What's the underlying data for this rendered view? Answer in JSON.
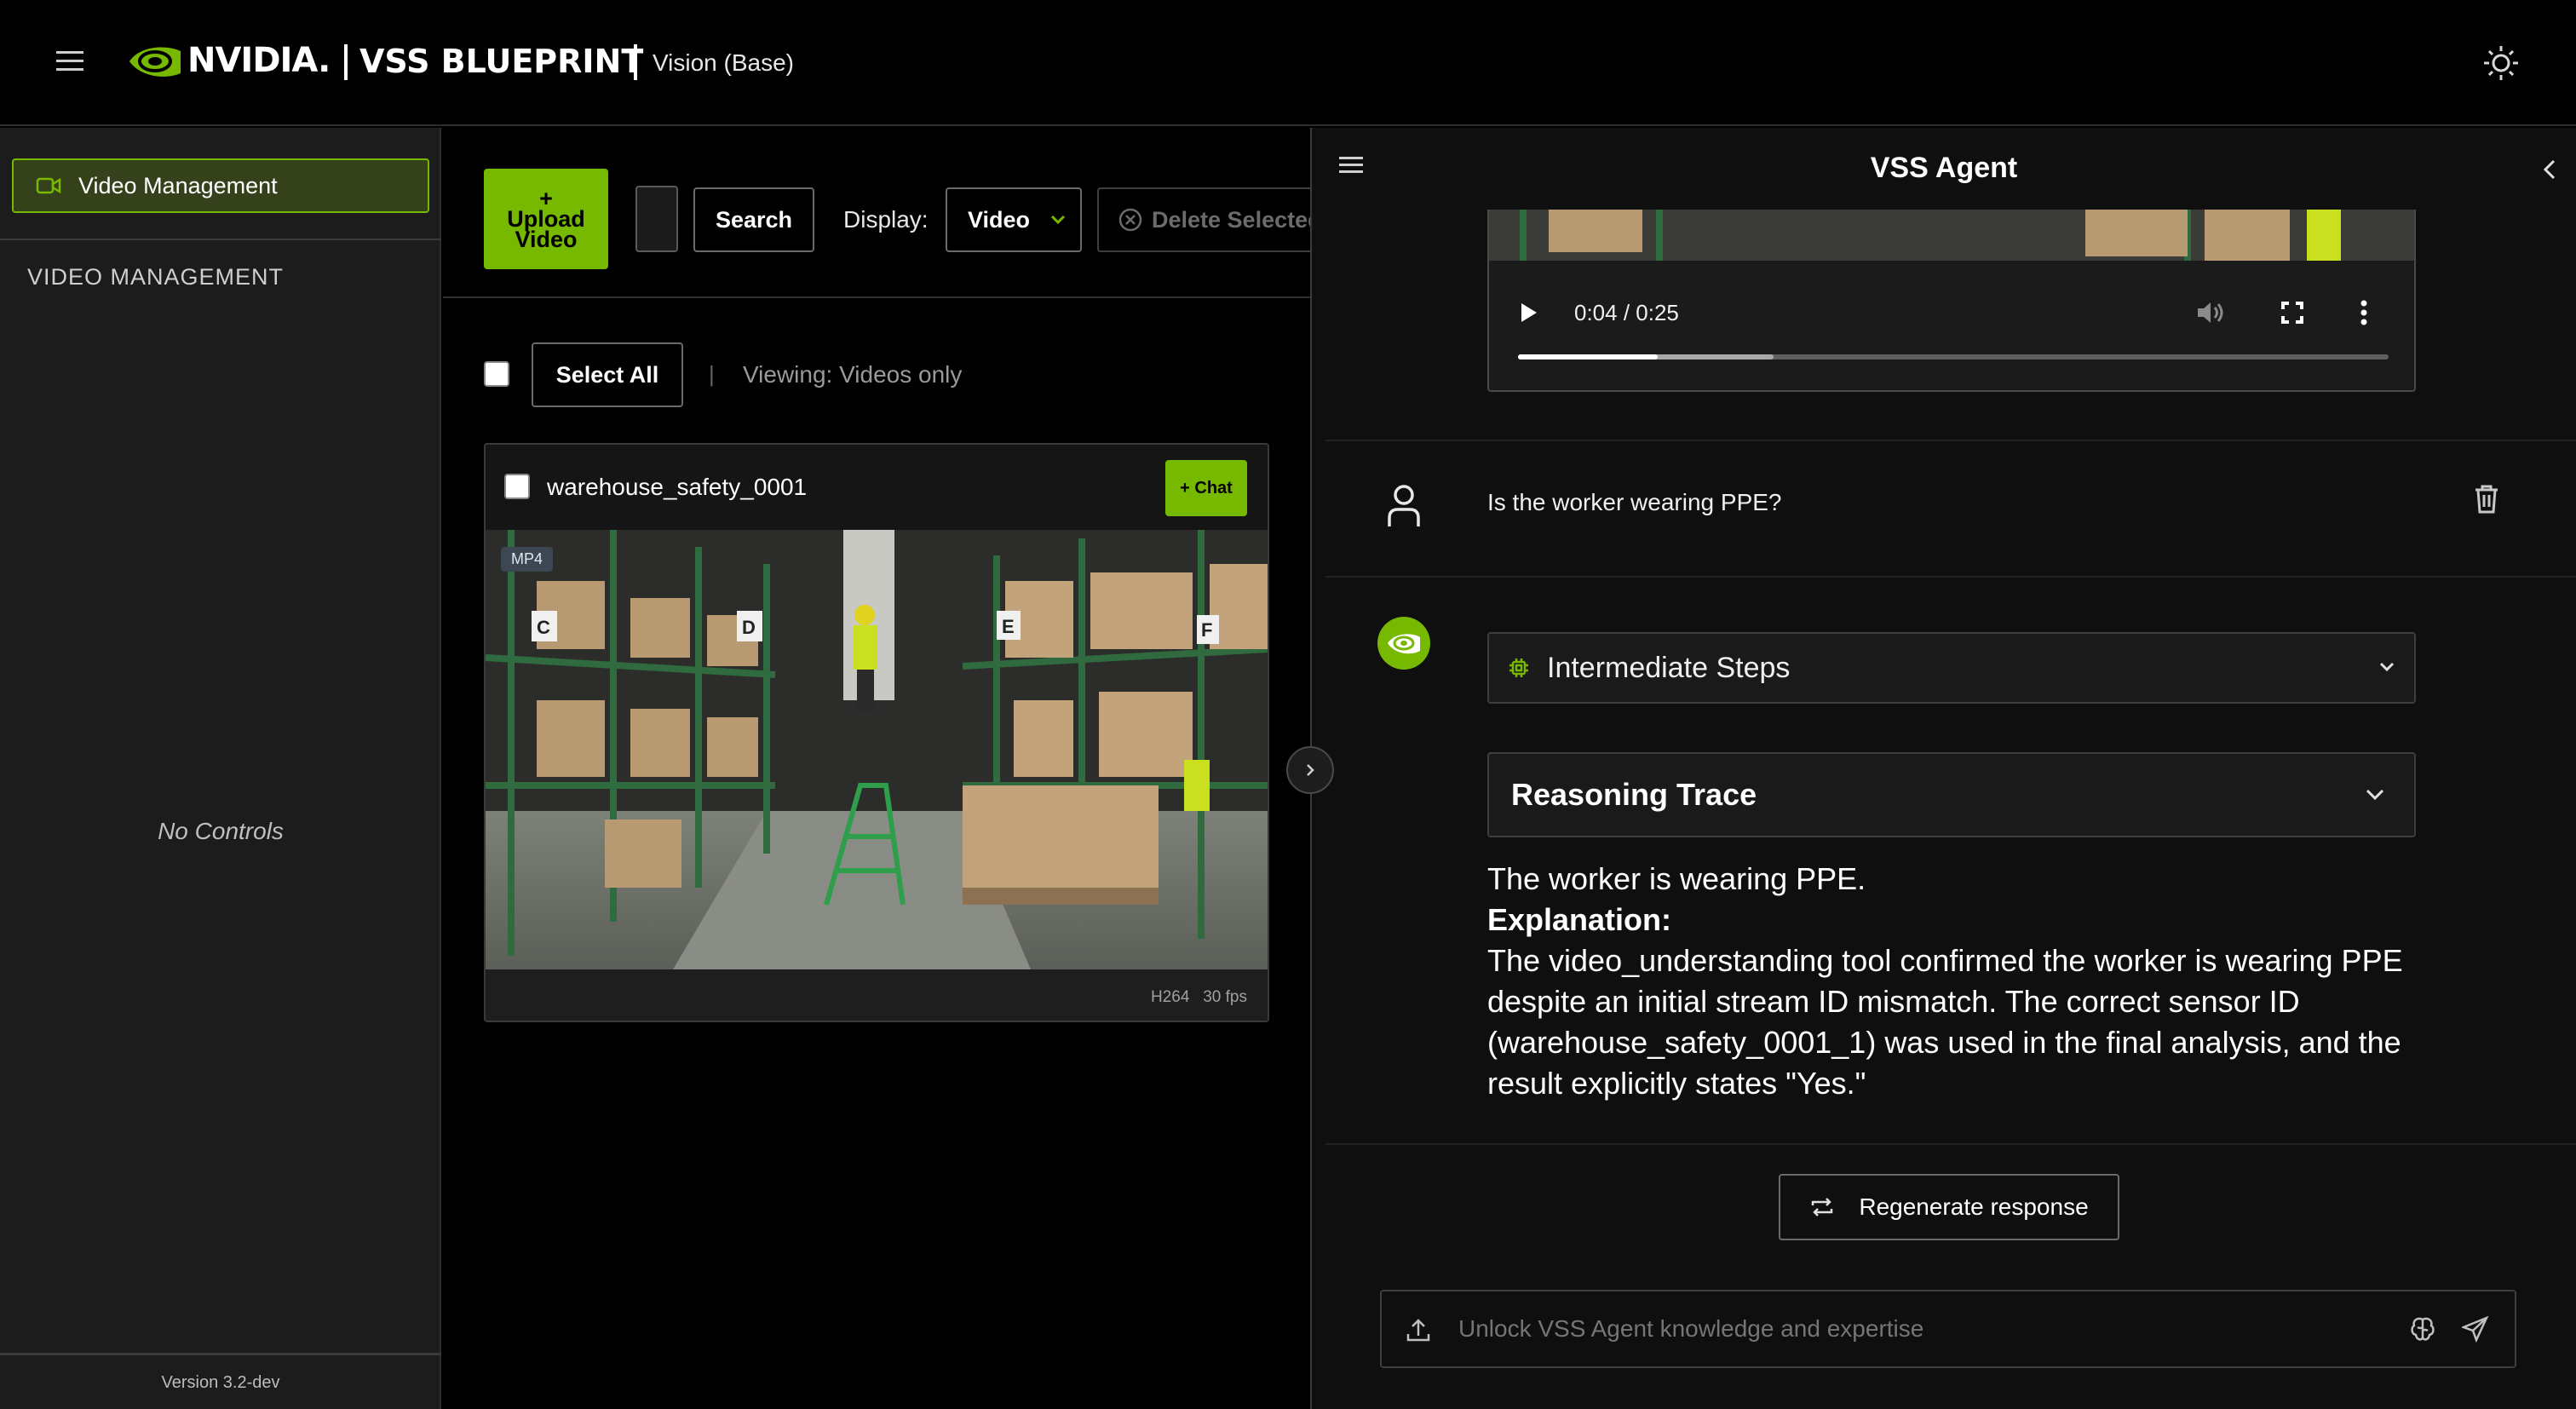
{
  "header": {
    "brand": "NVIDIA.",
    "product": "VSS BLUEPRINT",
    "mode": "Vision (Base)"
  },
  "sidebar": {
    "active_item": "Video Management",
    "section_title": "VIDEO MANAGEMENT",
    "empty_text": "No Controls",
    "version": "Version 3.2-dev"
  },
  "toolbar": {
    "upload_label": "+\nUpload\nVideo",
    "search_label": "Search",
    "display_label": "Display:",
    "display_value": "Video",
    "delete_label": "Delete Selected"
  },
  "selection": {
    "select_all_label": "Select All",
    "separator": "|",
    "viewing_text": "Viewing: Videos only"
  },
  "videos": [
    {
      "name": "warehouse_safety_0001",
      "chat_label": "+ Chat",
      "format": "MP4",
      "codec": "H264",
      "fps": "30 fps"
    }
  ],
  "chat": {
    "title": "VSS Agent",
    "player": {
      "time": "0:04 / 0:25",
      "progress": 0.16
    },
    "user_message": "Is the worker wearing PPE?",
    "steps_label": "Intermediate Steps",
    "trace_label": "Reasoning Trace",
    "answer_line1": "The worker is wearing PPE.",
    "answer_heading": "Explanation:",
    "answer_body": "The video_understanding tool confirmed the worker is wearing PPE despite an initial stream ID mismatch. The correct sensor ID (warehouse_safety_0001_1) was used in the final analysis, and the result explicitly states \"Yes.\"",
    "regenerate_label": "Regenerate response",
    "input_placeholder": "Unlock VSS Agent knowledge and expertise"
  },
  "colors": {
    "accent": "#76b900",
    "background": "#000000",
    "panel": "#1c1c1c"
  }
}
